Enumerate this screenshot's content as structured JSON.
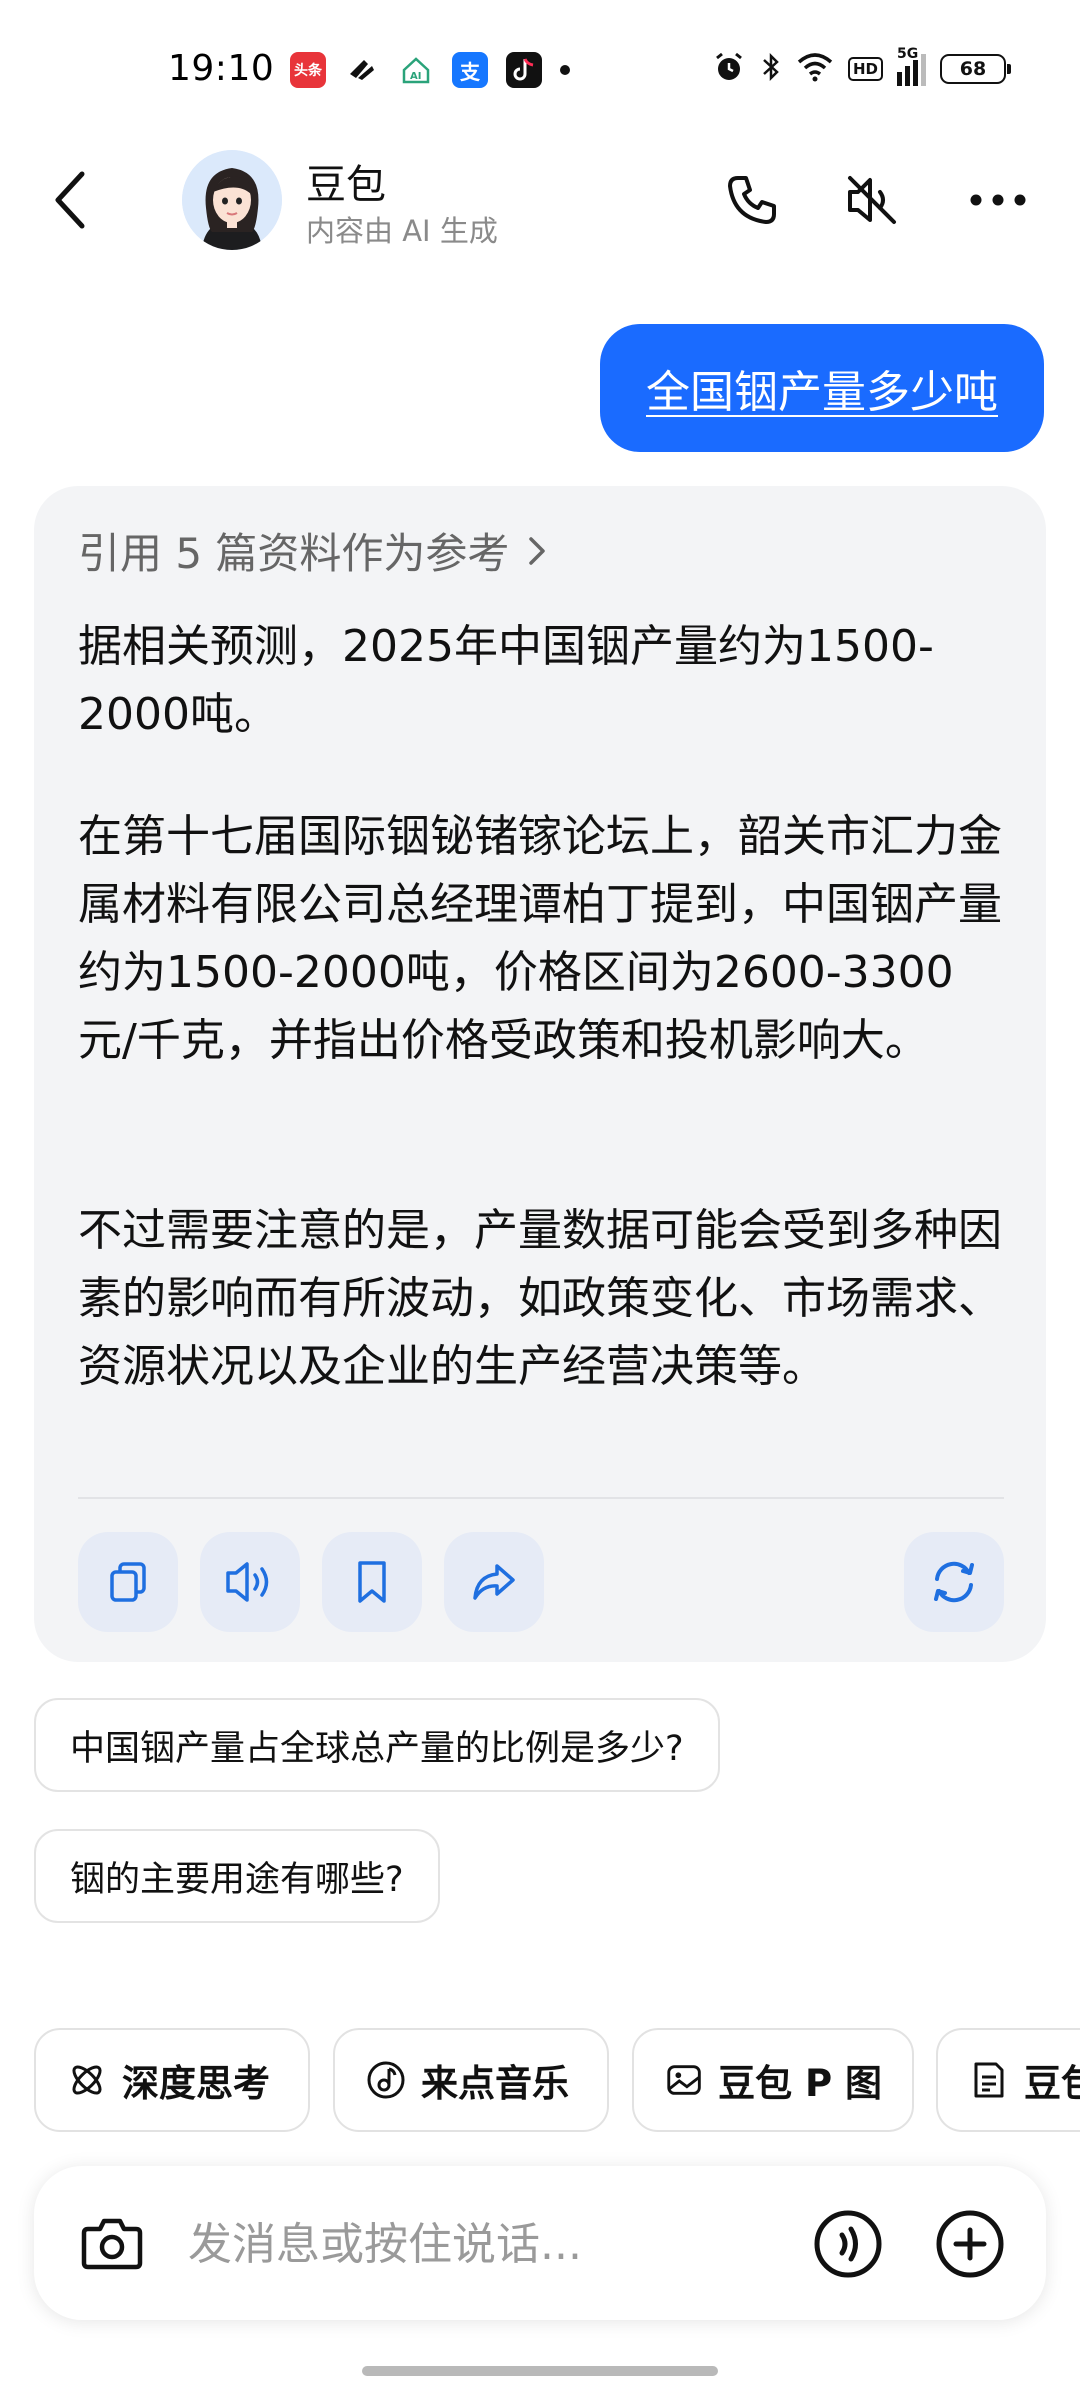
{
  "status_bar": {
    "time": "19:10",
    "app_icons": [
      "toutiao-icon",
      "feishu-icon",
      "ai-home-icon",
      "alipay-icon",
      "douyin-icon"
    ],
    "toutiao_label": "头条",
    "alipay_label": "支",
    "hd_label": "HD",
    "network_label": "5G",
    "battery": "68"
  },
  "header": {
    "bot_name": "豆包",
    "subtitle": "内容由 AI 生成"
  },
  "user_message": "全国铟产量多少吨",
  "ai_card": {
    "reference_label": "引用 5 篇资料作为参考",
    "paragraphs": [
      "据相关预测，2025年中国铟产量约为1500-2000吨。",
      "在第十七届国际铟铋锗镓论坛上，韶关市汇力金属材料有限公司总经理谭柏丁提到，中国铟产量约为1500-2000吨，价格区间为2600-3300元/千克，并指出价格受政策和投机影响大。",
      "不过需要注意的是，产量数据可能会受到多种因素的影响而有所波动，如政策变化、市场需求、资源状况以及企业的生产经营决策等。"
    ],
    "actions": [
      "copy-icon",
      "speaker-icon",
      "bookmark-icon",
      "share-icon",
      "regenerate-icon"
    ]
  },
  "suggestions": [
    "中国铟产量占全球总产量的比例是多少?",
    "铟的主要用途有哪些?"
  ],
  "chips": [
    {
      "label": "深度思考",
      "icon": "deep-think-icon"
    },
    {
      "label": "来点音乐",
      "icon": "music-icon"
    },
    {
      "label": "豆包 P 图",
      "icon": "photo-edit-icon"
    },
    {
      "label": "豆包",
      "icon": "document-icon"
    }
  ],
  "input": {
    "placeholder": "发消息或按住说话..."
  },
  "colors": {
    "accent": "#1a6bff",
    "card_bg": "#f3f4f6",
    "action_bg": "#e6ebf6",
    "icon_blue": "#1f6fe0"
  }
}
